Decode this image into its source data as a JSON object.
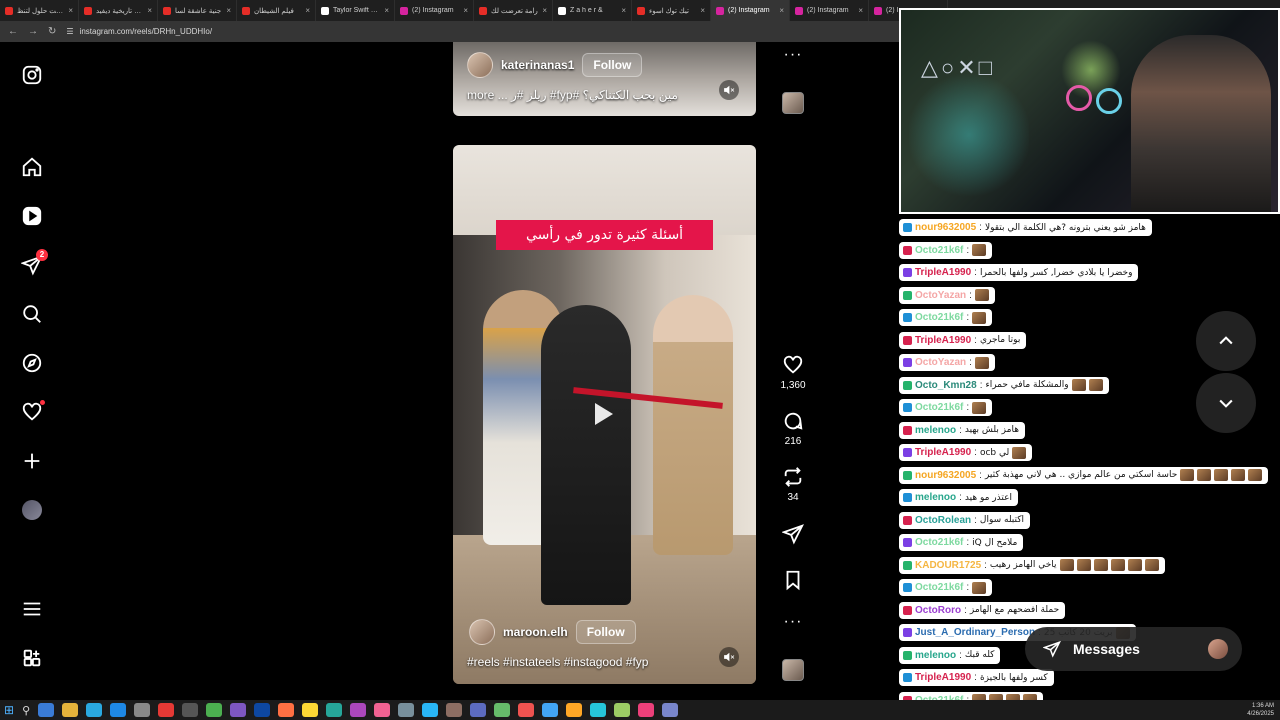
{
  "tabs": [
    {
      "title": "جربت حلول لتنظ",
      "color": "#e52d27"
    },
    {
      "title": "حلقة تاريخية ديفيد",
      "color": "#e52d27"
    },
    {
      "title": "جنية عاشقة لسا",
      "color": "#e52d27"
    },
    {
      "title": "فيلم الشيطان",
      "color": "#e52d27"
    },
    {
      "title": "Taylor Swift Edi",
      "color": "#ffffff"
    },
    {
      "title": "(2) Instagram",
      "color": "#d6249f"
    },
    {
      "title": "رامة تعرضت لك",
      "color": "#e52d27"
    },
    {
      "title": "Z a h e r &",
      "color": "#ffffff"
    },
    {
      "title": "تيك توك اسوء",
      "color": "#e52d27"
    },
    {
      "title": "(2) Instagram",
      "color": "#d6249f"
    },
    {
      "title": "(2) Instagram",
      "color": "#d6249f"
    },
    {
      "title": "(2) Ins",
      "color": "#d6249f"
    }
  ],
  "address": {
    "url": "instagram.com/reels/DRHn_UDDHIo/"
  },
  "sidebar": {
    "notification_count": "2"
  },
  "reel_top": {
    "username": "katerinanas1",
    "follow_label": "Follow",
    "caption": "more ... ريلز #ر #fyp# مين بحب الكتناكي؟"
  },
  "reel_main": {
    "banner_text": "أسئلة كثيرة تدور في رأسي",
    "username": "maroon.elh",
    "follow_label": "Follow",
    "caption": "#reels #instateels #instagood #fyp"
  },
  "actions": {
    "likes": "1,360",
    "comments": "216",
    "reposts": "34"
  },
  "chat": [
    {
      "user": "nour9632005",
      "color": "#f5a623",
      "text": "هامز شو يعني بترونه ?هي الكلمة الي بتقولا",
      "emotes": 0
    },
    {
      "user": "Octo21k6f",
      "color": "#7ed9a0",
      "text": "",
      "emotes": 1
    },
    {
      "user": "TripleA1990",
      "color": "#d6224e",
      "text": "وخضرا يا بلادي خضرا, كسر ولفها بالحمرا",
      "emotes": 0
    },
    {
      "user": "OctoYazan",
      "color": "#f4a6a6",
      "text": "",
      "emotes": 1
    },
    {
      "user": "Octo21k6f",
      "color": "#7ed9a0",
      "text": "",
      "emotes": 1
    },
    {
      "user": "TripleA1990",
      "color": "#d6224e",
      "text": "بوتا ماجري",
      "emotes": 0
    },
    {
      "user": "OctoYazan",
      "color": "#f4a6a6",
      "text": "",
      "emotes": 1
    },
    {
      "user": "Octo_Kmn28",
      "color": "#2b8a7a",
      "text": "والمشكلة مافي حمراء",
      "emotes": 2
    },
    {
      "user": "Octo21k6f",
      "color": "#7ed9a0",
      "text": "",
      "emotes": 1
    },
    {
      "user": "melenoo",
      "color": "#28a68c",
      "text": "هامز بلش بهيد",
      "emotes": 0
    },
    {
      "user": "TripleA1990",
      "color": "#d6224e",
      "text": "لي ocb",
      "emotes": 1
    },
    {
      "user": "nour9632005",
      "color": "#f5a623",
      "text": "حاسة اسكتي من عالم موازي .. هي لاني مهذبة كثير",
      "emotes": 5
    },
    {
      "user": "melenoo",
      "color": "#28a68c",
      "text": "اعتذر مو هيد",
      "emotes": 0
    },
    {
      "user": "OctoRolean",
      "color": "#2aa198",
      "text": "اكتبله سوال",
      "emotes": 0
    },
    {
      "user": "Octo21k6f",
      "color": "#7ed9a0",
      "text": "ملامح ال iQ",
      "emotes": 0
    },
    {
      "user": "KADOUR1725",
      "color": "#f5b642",
      "text": "ياخي الهامز رهيب",
      "emotes": 6
    },
    {
      "user": "Octo21k6f",
      "color": "#7ed9a0",
      "text": "",
      "emotes": 1
    },
    {
      "user": "OctoRoro",
      "color": "#9b3fd1",
      "text": "حملة افضحهم مع الهامز",
      "emotes": 0
    },
    {
      "user": "Just_A_Ordinary_Person",
      "color": "#2b6cb0",
      "text": "بريت 20 كاتب 25",
      "emotes": 1
    },
    {
      "user": "melenoo",
      "color": "#28a68c",
      "text": "كله قبك",
      "emotes": 0
    },
    {
      "user": "TripleA1990",
      "color": "#d6224e",
      "text": "كسر ولفها بالجيزة",
      "emotes": 0
    },
    {
      "user": "Octo21k6f",
      "color": "#7ed9a0",
      "text": "",
      "emotes": 4
    }
  ],
  "messages_pill": {
    "label": "Messages"
  },
  "clock": {
    "time": "1:36 AM",
    "date": "4/26/2025"
  },
  "colors": {
    "accent": "#ff3040",
    "banner": "#e4154a"
  }
}
